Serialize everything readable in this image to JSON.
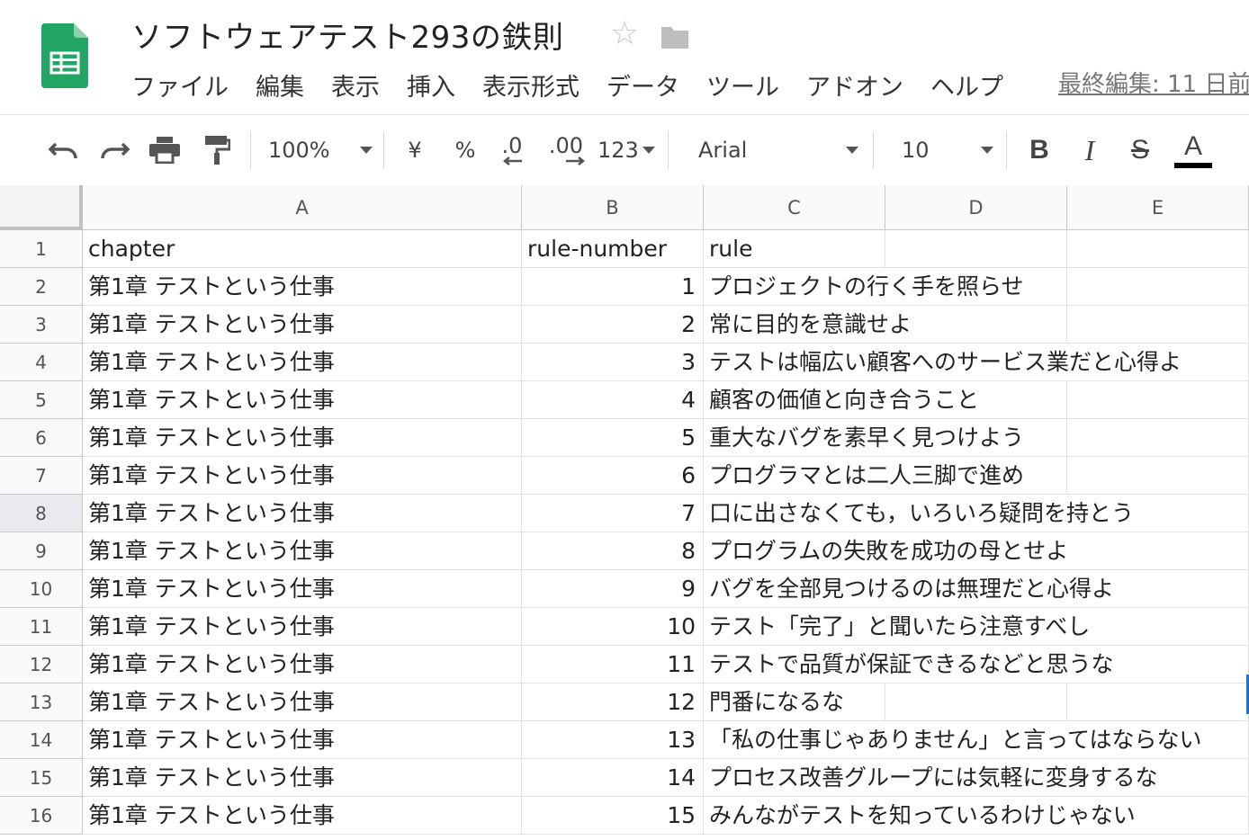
{
  "header": {
    "title": "ソフトウェアテスト293の鉄則",
    "star_glyph": "☆",
    "last_edit": "最終編集: 11 日前",
    "menu": [
      "ファイル",
      "編集",
      "表示",
      "挿入",
      "表示形式",
      "データ",
      "ツール",
      "アドオン",
      "ヘルプ"
    ]
  },
  "toolbar": {
    "zoom": "100%",
    "currency": "¥",
    "percent": "%",
    "decrease_decimal": ".0",
    "increase_decimal": ".00",
    "more_formats": "123",
    "font": "Arial",
    "font_size": "10",
    "bold": "B",
    "italic": "I",
    "strike": "S",
    "text_color": "A"
  },
  "colors": {
    "sheets_green": "#23a566",
    "sheets_green_dark": "#188038",
    "selection_blue": "#1a73e8"
  },
  "grid": {
    "columns": [
      "A",
      "B",
      "C",
      "D",
      "E"
    ],
    "rows": [
      {
        "n": "1",
        "a": "chapter",
        "b": "rule-number",
        "c": "rule"
      },
      {
        "n": "2",
        "a": "第1章 テストという仕事",
        "b": "1",
        "c": "プロジェクトの行く手を照らせ"
      },
      {
        "n": "3",
        "a": "第1章 テストという仕事",
        "b": "2",
        "c": "常に目的を意識せよ"
      },
      {
        "n": "4",
        "a": "第1章 テストという仕事",
        "b": "3",
        "c": "テストは幅広い顧客へのサービス業だと心得よ"
      },
      {
        "n": "5",
        "a": "第1章 テストという仕事",
        "b": "4",
        "c": "顧客の価値と向き合うこと"
      },
      {
        "n": "6",
        "a": "第1章 テストという仕事",
        "b": "5",
        "c": "重大なバグを素早く見つけよう"
      },
      {
        "n": "7",
        "a": "第1章 テストという仕事",
        "b": "6",
        "c": "プログラマとは二人三脚で進め"
      },
      {
        "n": "8",
        "a": "第1章 テストという仕事",
        "b": "7",
        "c": "口に出さなくても，いろいろ疑問を持とう"
      },
      {
        "n": "9",
        "a": "第1章 テストという仕事",
        "b": "8",
        "c": "プログラムの失敗を成功の母とせよ"
      },
      {
        "n": "10",
        "a": "第1章 テストという仕事",
        "b": "9",
        "c": "バグを全部見つけるのは無理だと心得よ"
      },
      {
        "n": "11",
        "a": "第1章 テストという仕事",
        "b": "10",
        "c": "テスト「完了」と聞いたら注意すべし"
      },
      {
        "n": "12",
        "a": "第1章 テストという仕事",
        "b": "11",
        "c": "テストで品質が保証できるなどと思うな"
      },
      {
        "n": "13",
        "a": "第1章 テストという仕事",
        "b": "12",
        "c": "門番になるな"
      },
      {
        "n": "14",
        "a": "第1章 テストという仕事",
        "b": "13",
        "c": "「私の仕事じゃありません」と言ってはならない"
      },
      {
        "n": "15",
        "a": "第1章 テストという仕事",
        "b": "14",
        "c": "プロセス改善グループには気軽に変身するな"
      },
      {
        "n": "16",
        "a": "第1章 テストという仕事",
        "b": "15",
        "c": "みんながテストを知っているわけじゃない"
      }
    ],
    "selected_row": "8"
  }
}
